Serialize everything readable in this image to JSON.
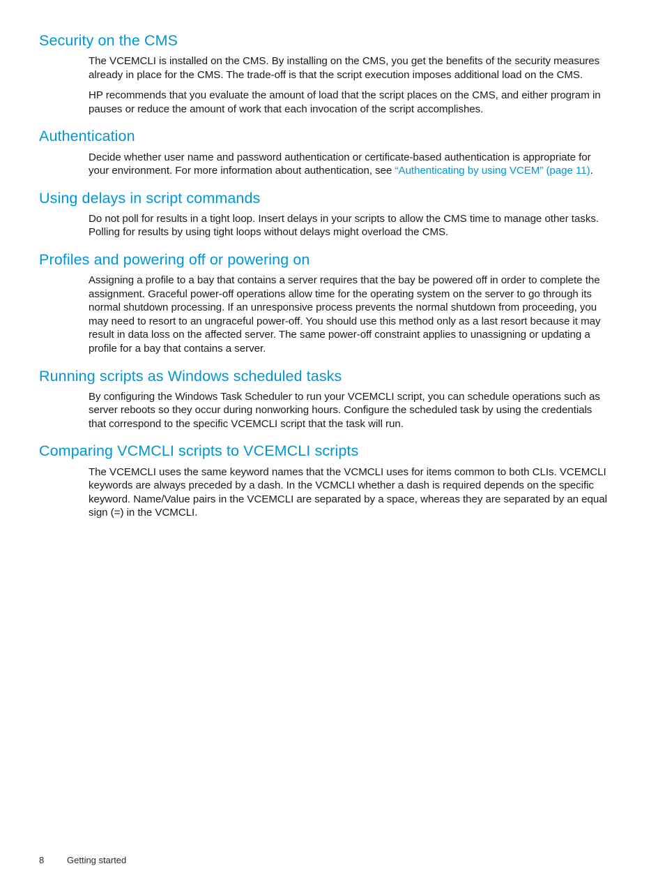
{
  "document": {
    "page_number": "8",
    "chapter_name": "Getting started",
    "heading_color": "#0096d6",
    "link_color": "#0096d6",
    "body_color": "#1a1a1a"
  },
  "sections": [
    {
      "heading": "Security on the CMS",
      "paragraphs": [
        "The VCEMCLI is installed on the CMS. By installing on the CMS, you get the benefits of the security measures already in place for the CMS. The trade-off is that the script execution imposes additional load on the CMS.",
        "HP recommends that you evaluate the amount of load that the script places on the CMS, and either program in pauses or reduce the amount of work that each invocation of the script accomplishes."
      ]
    },
    {
      "heading": "Authentication",
      "paragraph_before_link": "Decide whether user name and password authentication or certificate-based authentication is appropriate for your environment. For more information about authentication, see ",
      "link_text": "“Authenticating by using VCEM” (page 11)",
      "paragraph_after_link": "."
    },
    {
      "heading": "Using delays in script commands",
      "paragraphs": [
        "Do not poll for results in a tight loop. Insert delays in your scripts to allow the CMS time to manage other tasks. Polling for results by using tight loops without delays might overload the CMS."
      ]
    },
    {
      "heading": "Profiles and powering off or powering on",
      "paragraphs": [
        "Assigning a profile to a bay that contains a server requires that the bay be powered off in order to complete the assignment. Graceful power-off operations allow time for the operating system on the server to go through its normal shutdown processing. If an unresponsive process prevents the normal shutdown from proceeding, you may need to resort to an ungraceful power-off. You should use this method only as a last resort because it may result in data loss on the affected server. The same power-off constraint applies to unassigning or updating a profile for a bay that contains a server."
      ]
    },
    {
      "heading": "Running scripts as Windows scheduled tasks",
      "paragraphs": [
        "By configuring the Windows Task Scheduler to run your VCEMCLI script, you can schedule operations such as server reboots so they occur during nonworking hours. Configure the scheduled task by using the credentials that correspond to the specific VCEMCLI script that the task will run."
      ]
    },
    {
      "heading": "Comparing VCMCLI scripts to VCEMCLI scripts",
      "paragraphs": [
        "The VCEMCLI uses the same keyword names that the VCMCLI uses for items common to both CLIs. VCEMCLI keywords are always preceded by a dash. In the VCMCLI whether a dash is required depends on the specific keyword. Name/Value pairs in the VCEMCLI are separated by a space, whereas they are separated by an equal sign (=) in the VCMCLI."
      ]
    }
  ]
}
